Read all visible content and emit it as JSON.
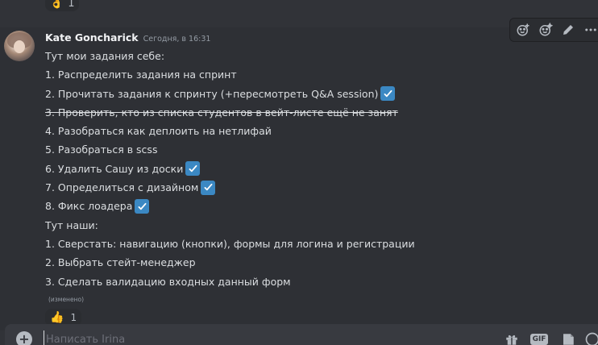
{
  "prev_reaction": {
    "emoji": "👌",
    "count": "1"
  },
  "message": {
    "author": "Kate Goncharick",
    "timestamp": "Сегодня, в 16:31",
    "lines": [
      {
        "text": "Тут мои задания себе:",
        "check": false,
        "strike": false
      },
      {
        "text": "1. Распределить задания на спринт",
        "check": false,
        "strike": false
      },
      {
        "text": "2. Прочитать задания к спринту (+пересмотреть Q&A session)",
        "check": true,
        "strike": false
      },
      {
        "text": "3. Проверить, кто из списка студентов в вейт-листе  ещё не занят",
        "check": false,
        "strike": true
      },
      {
        "text": "4. Разобраться как деплоить на нетлифай",
        "check": false,
        "strike": false
      },
      {
        "text": "5. Разобраться в scss",
        "check": false,
        "strike": false
      },
      {
        "text": "6. Удалить Сашу из доски",
        "check": true,
        "strike": false
      },
      {
        "text": "7. Определиться с дизайном",
        "check": true,
        "strike": false
      },
      {
        "text": "8. Фикс лоадера",
        "check": true,
        "strike": false
      },
      {
        "text": "Тут наши:",
        "check": false,
        "strike": false
      },
      {
        "text": "1. Сверстать: навигацию (кнопки), формы для логина и регистрации",
        "check": false,
        "strike": false
      },
      {
        "text": "2. Выбрать стейт-менеджер",
        "check": false,
        "strike": false
      },
      {
        "text": "3. Сделать валидацию входных данный форм",
        "check": false,
        "strike": false
      }
    ],
    "edited_label": "(изменено)",
    "reaction": {
      "emoji": "👍",
      "count": "1"
    }
  },
  "toolbar": {
    "icons": [
      "add-reaction-icon",
      "super-reaction-icon",
      "edit-icon",
      "more-icon"
    ]
  },
  "composer": {
    "placeholder": "Написать Irina",
    "icons": [
      "gift-icon",
      "gif-icon",
      "sticker-icon",
      "emoji-icon"
    ],
    "gif_label": "GIF"
  },
  "colors": {
    "background": "#313338",
    "hover": "#2e3035",
    "checkmark": "#3b88c3"
  }
}
